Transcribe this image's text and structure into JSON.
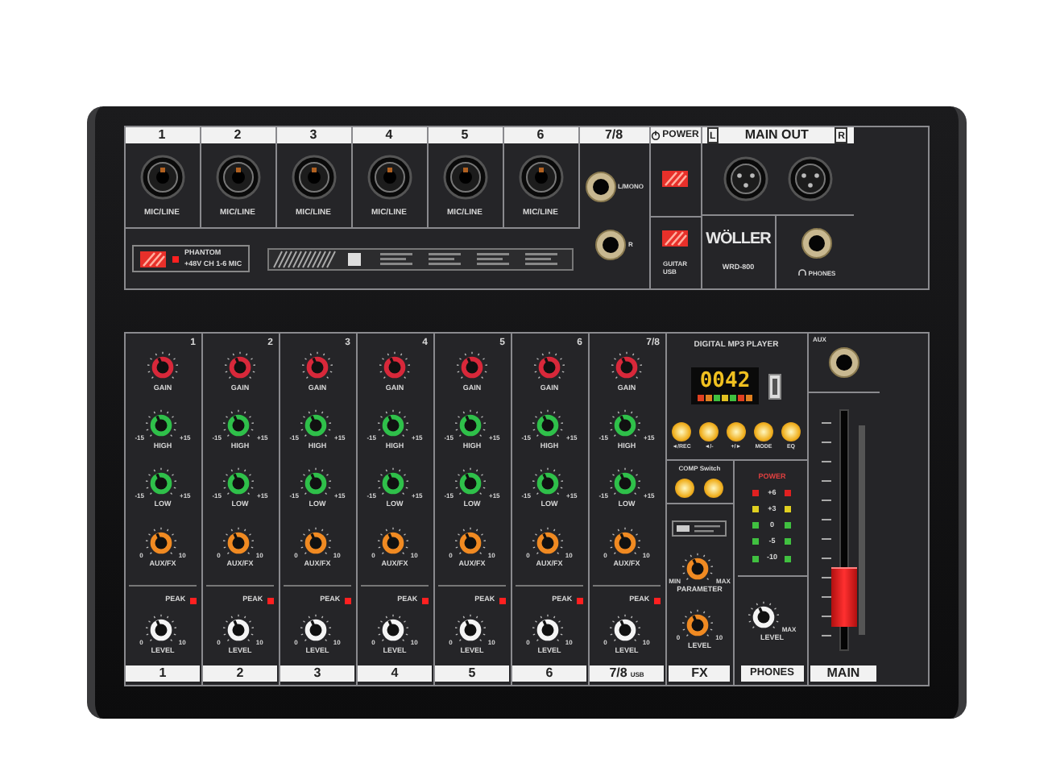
{
  "top_panel": {
    "inputs": [
      {
        "number": "1",
        "label": "MIC/LINE"
      },
      {
        "number": "2",
        "label": "MIC/LINE"
      },
      {
        "number": "3",
        "label": "MIC/LINE"
      },
      {
        "number": "4",
        "label": "MIC/LINE"
      },
      {
        "number": "5",
        "label": "MIC/LINE"
      },
      {
        "number": "6",
        "label": "MIC/LINE"
      }
    ],
    "stereo_input": {
      "number": "7/8",
      "left_label": "L/MONO",
      "right_label": "R"
    },
    "power": {
      "label": "POWER",
      "source_labels": [
        "GUITAR",
        "USB"
      ]
    },
    "main_out": {
      "label": "MAIN OUT",
      "left": "L",
      "right": "R"
    },
    "phantom": {
      "label": "PHANTOM",
      "sub_label": "+48V CH 1-6 MIC",
      "led_on": true
    },
    "brand": {
      "name": "WÖLLER",
      "model": "WRD-800"
    },
    "phones_label": "PHONES"
  },
  "channels": [
    {
      "number": "1",
      "corner_number": "1",
      "peak_label": "PEAK",
      "peak_lit": true,
      "knobs": [
        {
          "kind": "gain",
          "label": "GAIN"
        },
        {
          "kind": "high",
          "label": "HIGH",
          "min": "-15",
          "max": "+15"
        },
        {
          "kind": "low",
          "label": "LOW",
          "min": "-15",
          "max": "+15"
        },
        {
          "kind": "aux",
          "label": "AUX/FX",
          "min": "0",
          "max": "10"
        },
        {
          "kind": "level",
          "label": "LEVEL",
          "min": "0",
          "max": "10"
        }
      ]
    },
    {
      "number": "2",
      "corner_number": "2",
      "peak_label": "PEAK",
      "peak_lit": true,
      "knobs": [
        {
          "kind": "gain",
          "label": "GAIN"
        },
        {
          "kind": "high",
          "label": "HIGH",
          "min": "-15",
          "max": "+15"
        },
        {
          "kind": "low",
          "label": "LOW",
          "min": "-15",
          "max": "+15"
        },
        {
          "kind": "aux",
          "label": "AUX/FX",
          "min": "0",
          "max": "10"
        },
        {
          "kind": "level",
          "label": "LEVEL",
          "min": "0",
          "max": "10"
        }
      ]
    },
    {
      "number": "3",
      "corner_number": "3",
      "peak_label": "PEAK",
      "peak_lit": true,
      "knobs": [
        {
          "kind": "gain",
          "label": "GAIN"
        },
        {
          "kind": "high",
          "label": "HIGH",
          "min": "-15",
          "max": "+15"
        },
        {
          "kind": "low",
          "label": "LOW",
          "min": "-15",
          "max": "+15"
        },
        {
          "kind": "aux",
          "label": "AUX/FX",
          "min": "0",
          "max": "10"
        },
        {
          "kind": "level",
          "label": "LEVEL",
          "min": "0",
          "max": "10"
        }
      ]
    },
    {
      "number": "4",
      "corner_number": "4",
      "peak_label": "PEAK",
      "peak_lit": true,
      "knobs": [
        {
          "kind": "gain",
          "label": "GAIN"
        },
        {
          "kind": "high",
          "label": "HIGH",
          "min": "-15",
          "max": "+15"
        },
        {
          "kind": "low",
          "label": "LOW",
          "min": "-15",
          "max": "+15"
        },
        {
          "kind": "aux",
          "label": "AUX/FX",
          "min": "0",
          "max": "10"
        },
        {
          "kind": "level",
          "label": "LEVEL",
          "min": "0",
          "max": "10"
        }
      ]
    },
    {
      "number": "5",
      "corner_number": "5",
      "peak_label": "PEAK",
      "peak_lit": true,
      "knobs": [
        {
          "kind": "gain",
          "label": "GAIN"
        },
        {
          "kind": "high",
          "label": "HIGH",
          "min": "-15",
          "max": "+15"
        },
        {
          "kind": "low",
          "label": "LOW",
          "min": "-15",
          "max": "+15"
        },
        {
          "kind": "aux",
          "label": "AUX/FX",
          "min": "0",
          "max": "10"
        },
        {
          "kind": "level",
          "label": "LEVEL",
          "min": "0",
          "max": "10"
        }
      ]
    },
    {
      "number": "6",
      "corner_number": "6",
      "peak_label": "PEAK",
      "peak_lit": true,
      "knobs": [
        {
          "kind": "gain",
          "label": "GAIN"
        },
        {
          "kind": "high",
          "label": "HIGH",
          "min": "-15",
          "max": "+15"
        },
        {
          "kind": "low",
          "label": "LOW",
          "min": "-15",
          "max": "+15"
        },
        {
          "kind": "aux",
          "label": "AUX/FX",
          "min": "0",
          "max": "10"
        },
        {
          "kind": "level",
          "label": "LEVEL",
          "min": "0",
          "max": "10"
        }
      ]
    },
    {
      "number": "7/8",
      "corner_number": "7/8",
      "sub_label": "USB",
      "peak_label": "PEAK",
      "peak_lit": true,
      "knobs": [
        {
          "kind": "gain",
          "label": "GAIN"
        },
        {
          "kind": "high",
          "label": "HIGH",
          "min": "-15",
          "max": "+15"
        },
        {
          "kind": "low",
          "label": "LOW",
          "min": "-15",
          "max": "+15"
        },
        {
          "kind": "aux",
          "label": "AUX/FX",
          "min": "0",
          "max": "10"
        },
        {
          "kind": "level",
          "label": "LEVEL",
          "min": "0",
          "max": "10"
        }
      ]
    }
  ],
  "mp3_player": {
    "title": "DIGITAL MP3 PLAYER",
    "time": "0042",
    "buttons": [
      {
        "label": "◄/REC"
      },
      {
        "label": "◄/-"
      },
      {
        "label": "+/►"
      },
      {
        "label": "MODE"
      },
      {
        "label": "EQ"
      }
    ]
  },
  "fx": {
    "comp_label": "COMP Switch",
    "parameter": {
      "label": "PARAMETER",
      "min": "MIN",
      "max": "MAX"
    },
    "level": {
      "label": "LEVEL",
      "min": "0",
      "max": "10"
    },
    "name": "FX"
  },
  "meter": {
    "label": "POWER",
    "rows": [
      {
        "label": "+6",
        "color": "#e02020"
      },
      {
        "label": "+3",
        "color": "#e0d020"
      },
      {
        "label": "0",
        "color": "#40c040"
      },
      {
        "label": "-5",
        "color": "#40c040"
      },
      {
        "label": "-10",
        "color": "#40c040"
      }
    ]
  },
  "phones": {
    "level_label": "LEVEL",
    "max": "MAX",
    "name": "PHONES"
  },
  "main": {
    "aux_label": "AUX",
    "fader": {
      "level": 0.12
    },
    "name": "MAIN"
  }
}
